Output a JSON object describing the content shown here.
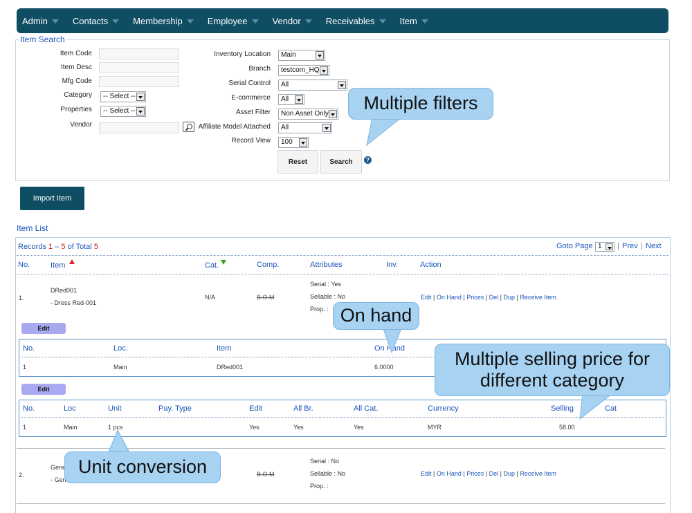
{
  "nav": [
    "Admin",
    "Contacts",
    "Membership",
    "Employee",
    "Vendor",
    "Receivables",
    "Item"
  ],
  "search": {
    "legend": "Item Search",
    "item_code": "Item Code",
    "item_desc": "Item Desc",
    "mfg_code": "Mfg Code",
    "category": "Category",
    "category_value": "-- Select --",
    "properties": "Properties",
    "properties_value": "-- Select --",
    "vendor": "Vendor",
    "inventory_location": "Inventory Location",
    "inventory_location_value": "Main",
    "branch": "Branch",
    "branch_value": "testcom_HQ",
    "serial_control": "Serial Control",
    "serial_control_value": "All",
    "ecommerce": "E-commerce",
    "ecommerce_value": "All",
    "asset_filter": "Asset Filter",
    "asset_filter_value": "Non Asset Only",
    "affiliate": "Affiliate Model Attached",
    "affiliate_value": "All",
    "record_view": "Record View",
    "record_view_value": "100",
    "reset": "Reset",
    "search_btn": "Search",
    "help": "?"
  },
  "import_button": "Import Item",
  "item_list": {
    "title": "Item List",
    "records_prefix": "Records ",
    "records_from": "1",
    "records_dash": " – ",
    "records_to": "5",
    "records_of": " of Total ",
    "records_total": "5",
    "goto_page": "Goto Page",
    "page_value": "1",
    "sep": "|",
    "prev": "Prev",
    "next": "Next",
    "headers": {
      "no": "No.",
      "item": "Item",
      "cat": "Cat.",
      "comp": "Comp.",
      "attributes": "Attributes",
      "inv": "Inv.",
      "action": "Action"
    },
    "actions": [
      "Edit",
      "On Hand",
      "Prices",
      "Del",
      "Dup",
      "Receive Item"
    ],
    "rows": [
      {
        "no": "1.",
        "code": "DRed001",
        "desc": "- Dress Red-001",
        "cat": "N/A",
        "comp": "B.O.M",
        "serial": "Serial : Yes",
        "sellable": "Sellable : No",
        "prop": "Prop. :"
      },
      {
        "no": "2.",
        "code": "Gene",
        "desc": "- Gene",
        "cat": "",
        "comp": "B.O.M",
        "serial": "Serial : No",
        "sellable": "Sellable : No",
        "prop": "Prop. :"
      }
    ],
    "edit_label": "Edit",
    "onhand_table": {
      "headers": {
        "no": "No.",
        "loc": "Loc.",
        "item": "Item",
        "onhand": "On Hand"
      },
      "row": {
        "no": "1",
        "loc": "Main",
        "item": "DRed001",
        "onhand": "6.0000"
      }
    },
    "price_table": {
      "headers": {
        "no": "No.",
        "loc": "Loc",
        "unit": "Unit",
        "pay_type": "Pay. Type",
        "edit": "Edit",
        "all_br": "All Br.",
        "all_cat": "All Cat.",
        "currency": "Currency",
        "selling": "Selling",
        "cat": "Cat"
      },
      "row": {
        "no": "1",
        "loc": "Main",
        "unit": "1 pcs",
        "edit": "Yes",
        "all_br": "Yes",
        "all_cat": "Yes",
        "currency": "MYR",
        "selling": "58.00"
      }
    }
  },
  "callouts": {
    "filters": "Multiple filters",
    "onhand": "On hand",
    "price": "Multiple selling price for different category",
    "unit": "Unit conversion"
  },
  "colors": {
    "nav_bg": "#0f4d63",
    "link": "#1a56b8",
    "callout": "#a7d2f2",
    "edit_btn": "#a9a9f2"
  }
}
